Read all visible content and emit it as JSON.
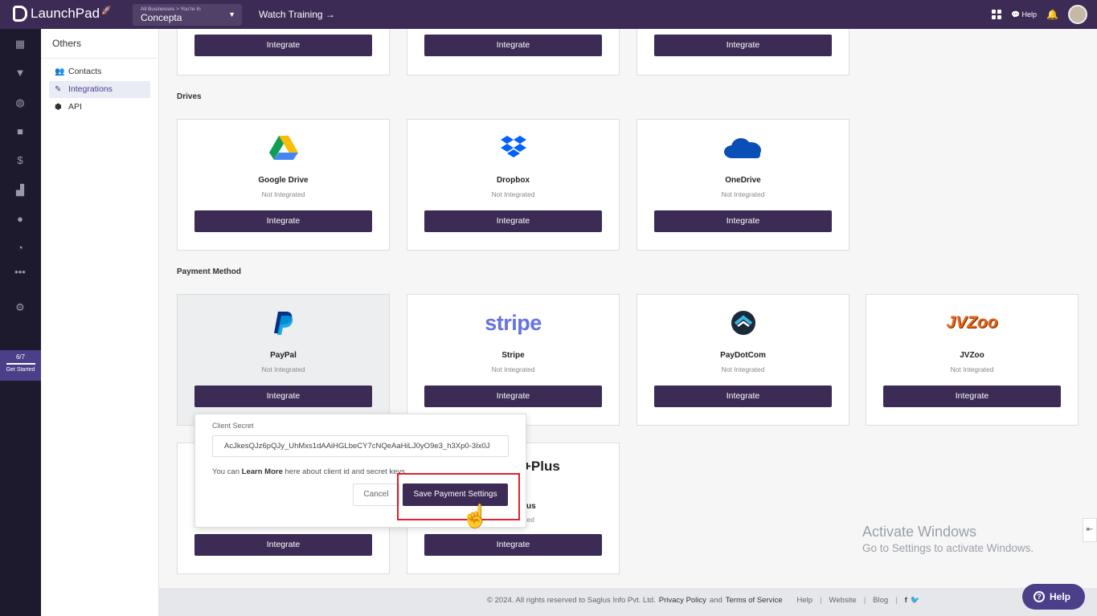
{
  "topbar": {
    "brand": "LaunchPad",
    "business_select_caption": "All Businesses > You're In",
    "business_select_value": "Concepta",
    "watch_training": "Watch Training →",
    "help": "Help"
  },
  "rail": {
    "get_started_progress": "6/7",
    "get_started_label": "Get Started"
  },
  "subnav": {
    "title": "Others",
    "items": [
      {
        "label": "Contacts",
        "icon": "contacts-icon"
      },
      {
        "label": "Integrations",
        "icon": "integrations-icon",
        "active": true
      },
      {
        "label": "API",
        "icon": "api-icon"
      }
    ]
  },
  "top_row": {
    "buttons": [
      "Integrate",
      "Integrate",
      "Integrate"
    ]
  },
  "drives": {
    "label": "Drives",
    "cards": [
      {
        "name": "Google Drive",
        "status": "Not Integrated",
        "button": "Integrate"
      },
      {
        "name": "Dropbox",
        "status": "Not Integrated",
        "button": "Integrate"
      },
      {
        "name": "OneDrive",
        "status": "Not Integrated",
        "button": "Integrate"
      }
    ]
  },
  "payment": {
    "label": "Payment Method",
    "cards": [
      {
        "name": "PayPal",
        "status": "Not Integrated",
        "button": "Integrate"
      },
      {
        "name": "Stripe",
        "status": "Not Integrated",
        "button": "Integrate",
        "logo_text": "stripe"
      },
      {
        "name": "PayDotCom",
        "status": "Not Integrated",
        "button": "Integrate"
      },
      {
        "name": "JVZoo",
        "status": "Not Integrated",
        "button": "Integrate",
        "logo_text": "JVZoo"
      }
    ],
    "row2": {
      "buttons": [
        "Integrate",
        "Integrate"
      ],
      "partial_logo": "+Plus",
      "partial_name": "us",
      "partial_status": "ted"
    }
  },
  "popover": {
    "label": "Client Secret",
    "value": "AcJkesQJz6pQJy_UhMxs1dAAiHGLbeCY7cNQeAaHiLJ0yO9e3_h3Xp0-3Ix0J",
    "hint_prefix": "You can ",
    "hint_link": "Learn More",
    "hint_suffix": " here about client id and secret keys",
    "cancel": "Cancel",
    "save": "Save Payment Settings"
  },
  "footer": {
    "copyright": "© 2024. All rights reserved to Saglus Info Pvt. Ltd.",
    "privacy": "Privacy Policy",
    "and": "and",
    "terms": "Terms of Service",
    "help": "Help",
    "website": "Website",
    "blog": "Blog"
  },
  "watermark": {
    "title": "Activate Windows",
    "subtitle": "Go to Settings to activate Windows."
  },
  "help_bubble": "Help",
  "colors": {
    "topbar": "#3b2b55",
    "rail": "#1c1a2c",
    "button": "#3b2b55",
    "highlight": "#e0202a"
  }
}
